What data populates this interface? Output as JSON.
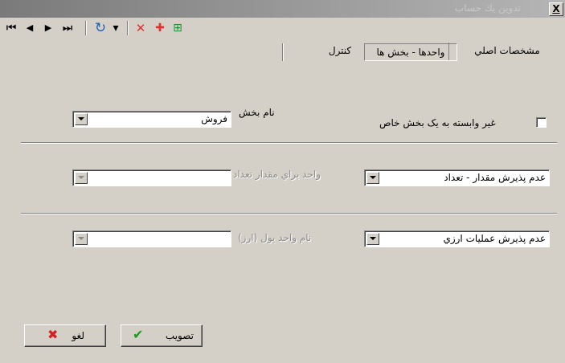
{
  "window": {
    "title": "تدوين يك حساب",
    "close_label": "X"
  },
  "toolbar": {
    "first_icon": "⏮",
    "prev_icon": "◀",
    "next_icon": "▶",
    "last_icon": "⏭",
    "refresh_icon": "↻",
    "dropdown_icon": "▾",
    "delete_icon": "✕",
    "add_icon": "✚",
    "tree_icon": "⊞"
  },
  "tabs": [
    {
      "label": "مشخصات اصلي"
    },
    {
      "label": "واحدها - بخش ها"
    },
    {
      "label": "كنترل"
    }
  ],
  "form": {
    "section_name_label": "نام بخش",
    "section_name_value": "فروش",
    "independent_checkbox_label": "غير وابسته به يک بخش خاص",
    "unit_quantity_label": "واحد براي مقدار تعداد",
    "unit_quantity_value": "",
    "quantity_mode_value": "عدم پذيرش مقدار - تعداد",
    "currency_unit_label": "نام واحد پول (ارز)",
    "currency_unit_value": "",
    "currency_mode_value": "عدم پذيرش عمليات ارزي"
  },
  "buttons": {
    "approve_label": "تصويب",
    "cancel_label": "لغو"
  },
  "colors": {
    "check_green": "#1a9b1a",
    "cross_red": "#d42020",
    "titlebar": "#9a9a9a"
  }
}
